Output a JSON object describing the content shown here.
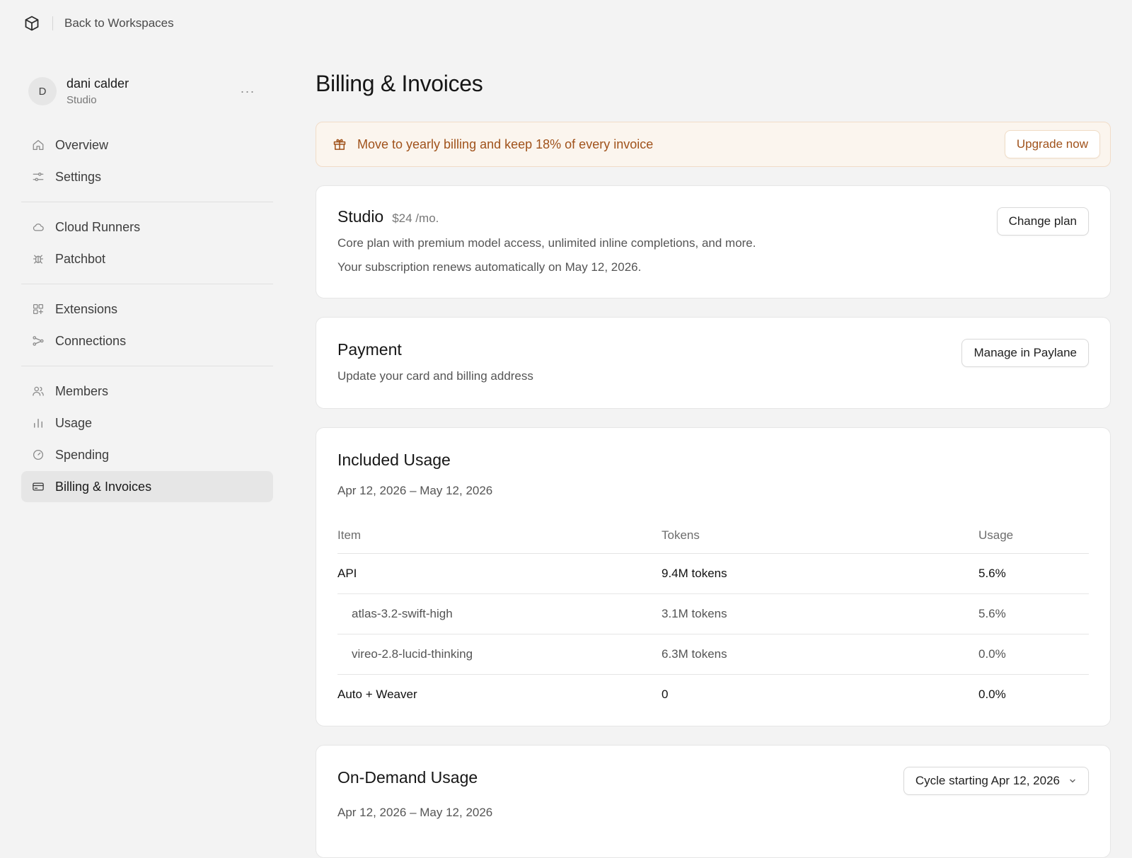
{
  "topbar": {
    "logo_icon": "cube-icon",
    "back_label": "Back to Workspaces"
  },
  "profile": {
    "initial": "D",
    "name": "dani calder",
    "plan": "Studio",
    "more_label": "···"
  },
  "sidebar": {
    "groups": [
      [
        {
          "label": "Overview",
          "icon": "home-icon"
        },
        {
          "label": "Settings",
          "icon": "sliders-icon"
        }
      ],
      [
        {
          "label": "Cloud Runners",
          "icon": "cloud-icon"
        },
        {
          "label": "Patchbot",
          "icon": "bug-icon"
        }
      ],
      [
        {
          "label": "Extensions",
          "icon": "grid-plus-icon"
        },
        {
          "label": "Connections",
          "icon": "connections-icon"
        }
      ],
      [
        {
          "label": "Members",
          "icon": "users-icon"
        },
        {
          "label": "Usage",
          "icon": "bar-chart-icon"
        },
        {
          "label": "Spending",
          "icon": "gauge-icon"
        },
        {
          "label": "Billing & Invoices",
          "icon": "credit-card-icon",
          "active": true
        }
      ]
    ]
  },
  "main": {
    "title": "Billing & Invoices",
    "promo": {
      "icon": "gift-icon",
      "text": "Move to yearly billing and keep 18% of every invoice",
      "button": "Upgrade now",
      "accent": "#a0521b"
    },
    "plan": {
      "name": "Studio",
      "price": "$24 /mo.",
      "description": "Core plan with premium model access, unlimited inline completions, and more.",
      "renewal": "Your subscription renews automatically on May 12, 2026.",
      "button": "Change plan"
    },
    "payment": {
      "title": "Payment",
      "subtitle": "Update your card and billing address",
      "button": "Manage in Paylane"
    },
    "included_usage": {
      "title": "Included Usage",
      "period": "Apr 12, 2026 – May 12, 2026",
      "columns": [
        "Item",
        "Tokens",
        "Usage"
      ],
      "rows": [
        {
          "item": "API",
          "tokens": "9.4M tokens",
          "usage": "5.6%",
          "level": "parent"
        },
        {
          "item": "atlas-3.2-swift-high",
          "tokens": "3.1M tokens",
          "usage": "5.6%",
          "level": "child"
        },
        {
          "item": "vireo-2.8-lucid-thinking",
          "tokens": "6.3M tokens",
          "usage": "0.0%",
          "level": "child"
        },
        {
          "item": "Auto + Weaver",
          "tokens": "0",
          "usage": "0.0%",
          "level": "parent"
        }
      ]
    },
    "on_demand": {
      "title": "On-Demand Usage",
      "period": "Apr 12, 2026 – May 12, 2026",
      "cycle_select": "Cycle starting Apr 12, 2026"
    }
  }
}
